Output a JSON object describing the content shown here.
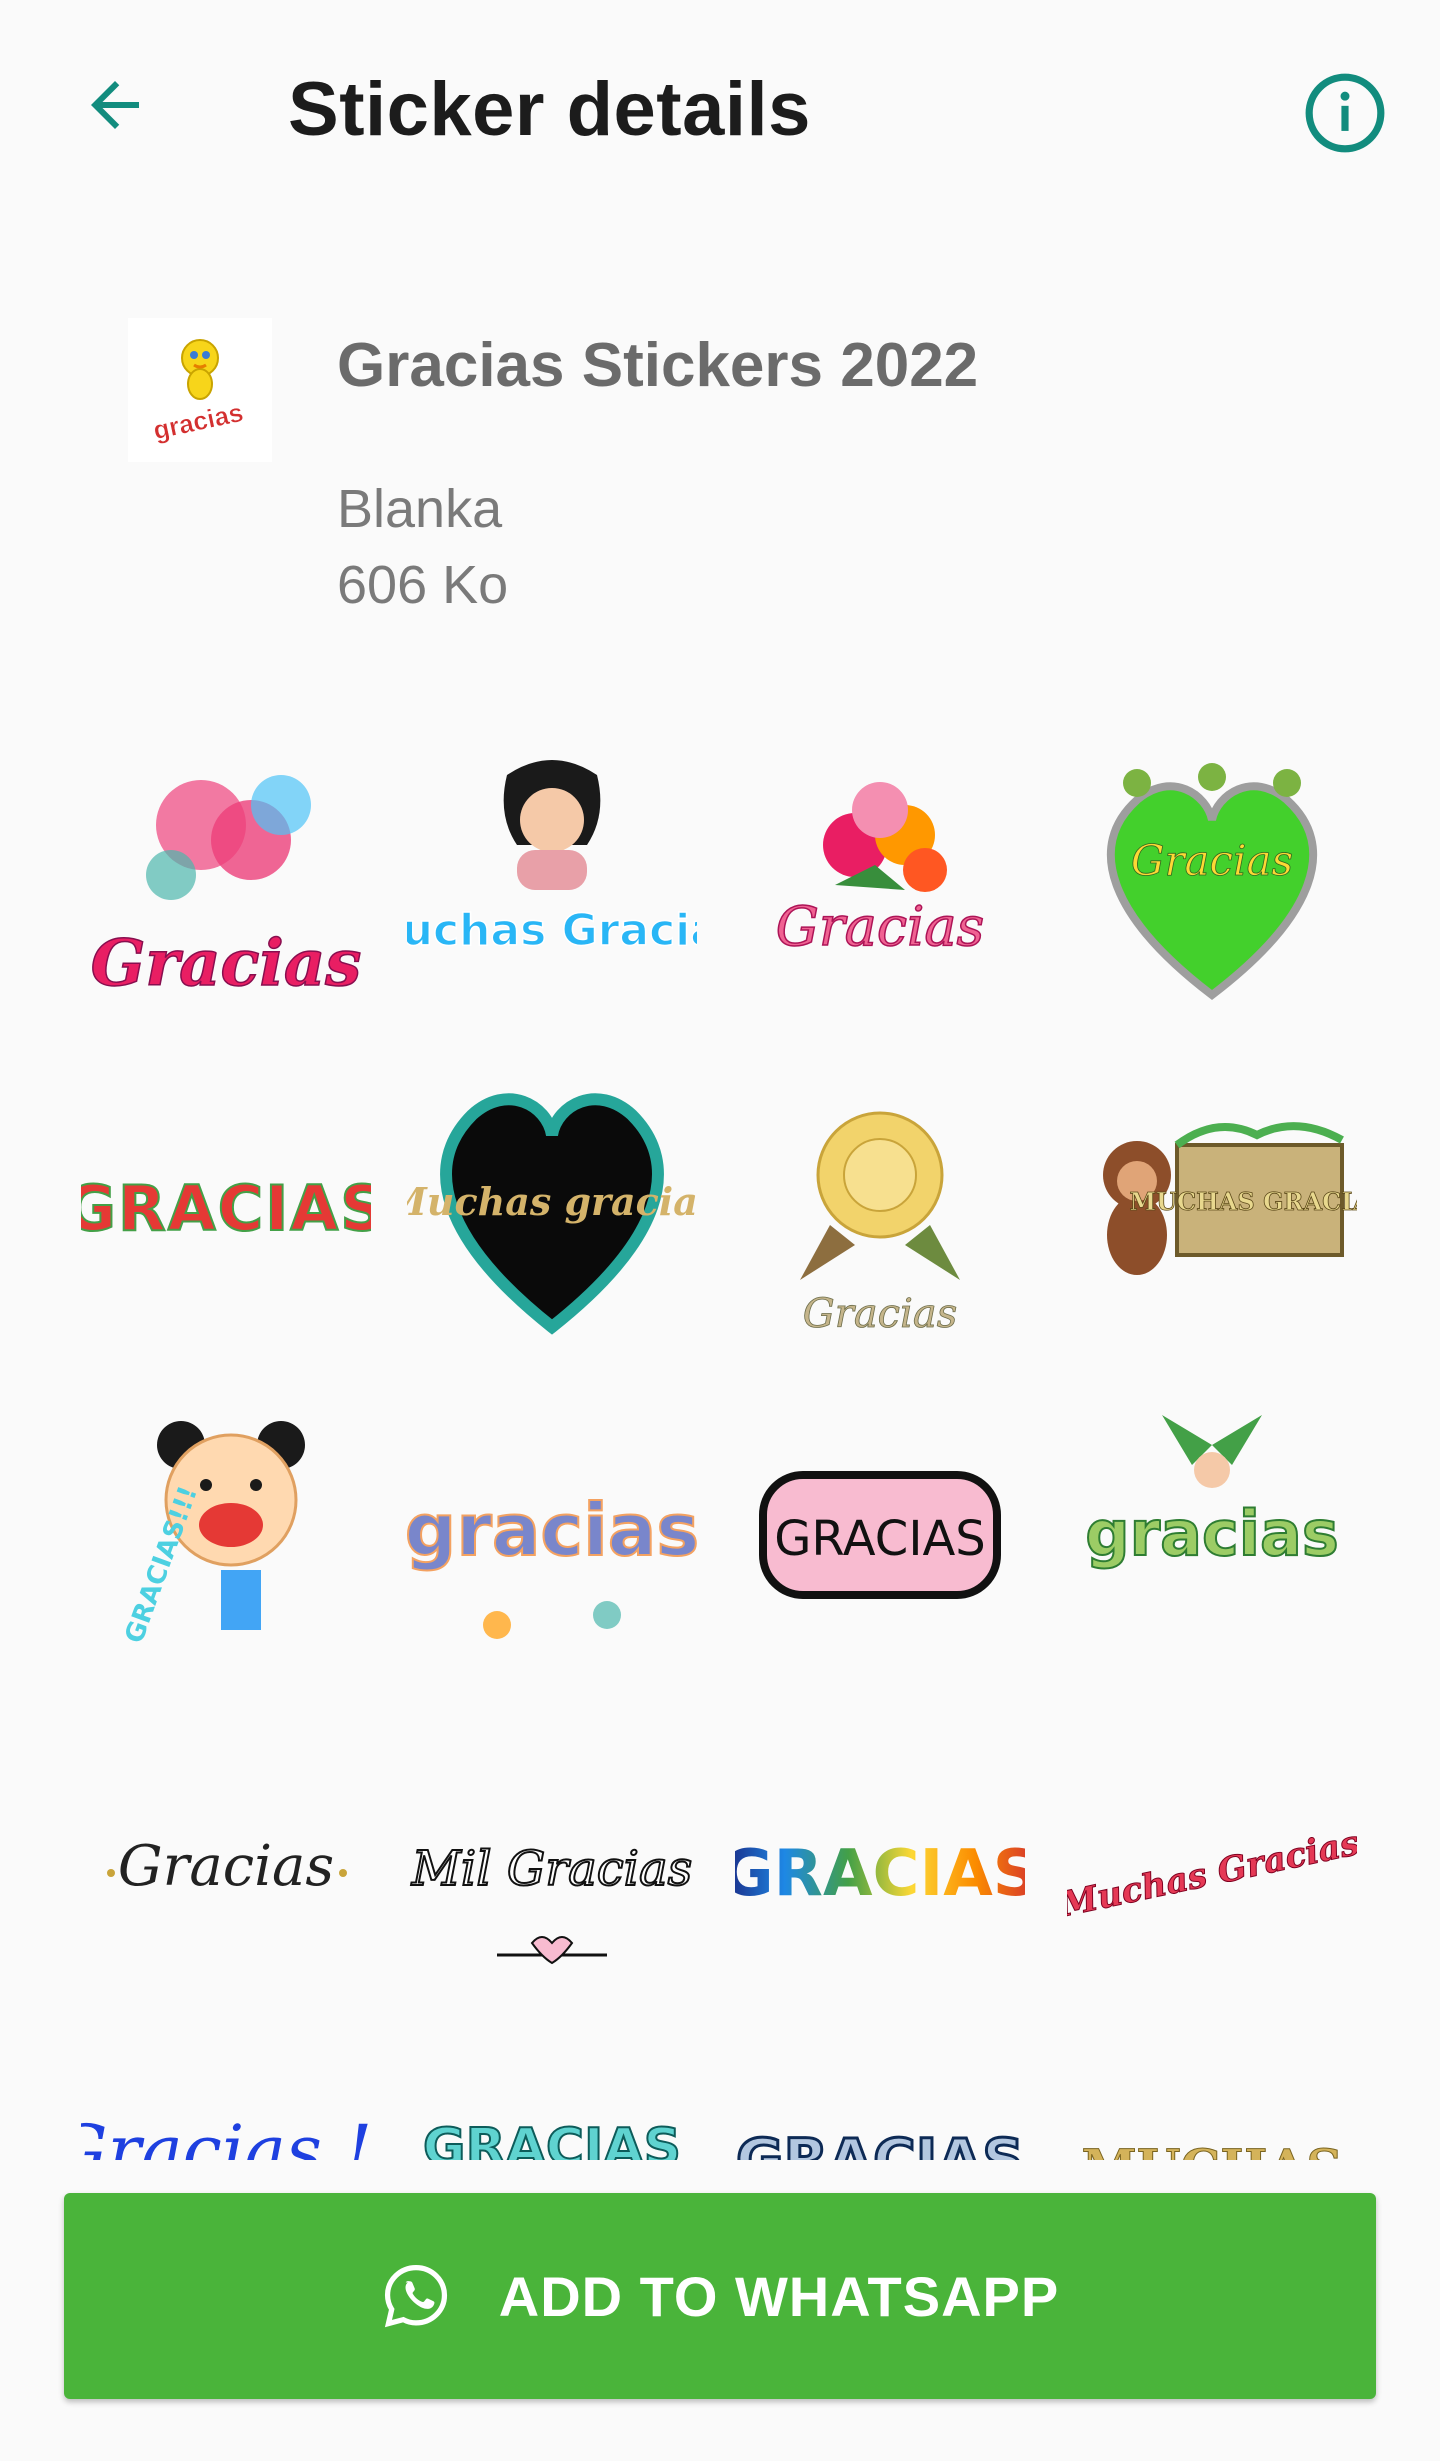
{
  "header": {
    "title": "Sticker details"
  },
  "pack": {
    "name": "Gracias Stickers 2022",
    "author": "Blanka",
    "size": "606 Ko",
    "thumbnail_text": "gracias"
  },
  "stickers": [
    {
      "text": "Gracias"
    },
    {
      "text": "Muchas Gracias"
    },
    {
      "text": "Gracias"
    },
    {
      "text": "Gracias"
    },
    {
      "text": "GRACIAS"
    },
    {
      "text": "Muchas gracias"
    },
    {
      "text": "Gracias"
    },
    {
      "text": "MUCHAS GRACIAS"
    },
    {
      "text": "GRACIAS!!!"
    },
    {
      "text": "gracias"
    },
    {
      "text": "GRACIAS"
    },
    {
      "text": "gracias"
    },
    {
      "text": "Gracias"
    },
    {
      "text": "Mil Gracias"
    },
    {
      "text": "GRACIAS"
    },
    {
      "text": "Muchas Gracias"
    },
    {
      "text": "Gracias !!"
    },
    {
      "text": "GRACIAS"
    },
    {
      "text": "GRACIAS"
    },
    {
      "text": "MUCHAS"
    }
  ],
  "actions": {
    "add_label": "ADD TO WHATSAPP"
  },
  "colors": {
    "accent": "#128c7e",
    "button": "#4ab43a",
    "background": "#fafafa"
  }
}
